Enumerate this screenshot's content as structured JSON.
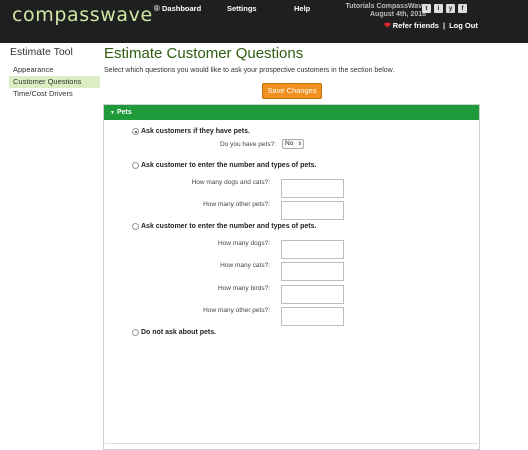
{
  "header": {
    "logo": "compasswave",
    "logo_mark": "®",
    "nav": [
      "Dashboard",
      "Settings",
      "Help"
    ],
    "company_name": "Tutorials CompassWave",
    "date": "August 4th, 2018",
    "socials": [
      "t",
      "i",
      "y",
      "f"
    ],
    "refer_label": "Refer friends",
    "separator": "|",
    "logout_label": "Log Out"
  },
  "sidebar": {
    "title": "Estimate Tool",
    "items": [
      "Appearance",
      "Customer Questions",
      "Time/Cost Drivers"
    ]
  },
  "main": {
    "title": "Estimate Customer Questions",
    "description": "Select which questions you would like to ask your prospective customers in the section below.",
    "save_label": "Save Changes",
    "section_title": "Pets",
    "options": [
      {
        "label": "Ask customers if they have pets.",
        "selected": true
      },
      {
        "label": "Ask customer to enter the number and types of pets.",
        "selected": false
      },
      {
        "label": "Ask customer to enter the number and types of pets.",
        "selected": false
      },
      {
        "label": "Do not ask about pets.",
        "selected": false
      }
    ],
    "have_pets_label": "Do you have pets?:",
    "have_pets_value": "No",
    "group1_fields": [
      "How many dogs and cats?:",
      "How many other pets?:"
    ],
    "group2_fields": [
      "How many dogs?:",
      "How many cats?:",
      "How many birds?:",
      "How many other pets?:"
    ]
  },
  "colors": {
    "header_bg": "#1f1f1f",
    "accent_green": "#1f9a3a",
    "title_green": "#2f5d14",
    "save_orange": "#f09020",
    "active_sidebar": "#dbedc2"
  }
}
